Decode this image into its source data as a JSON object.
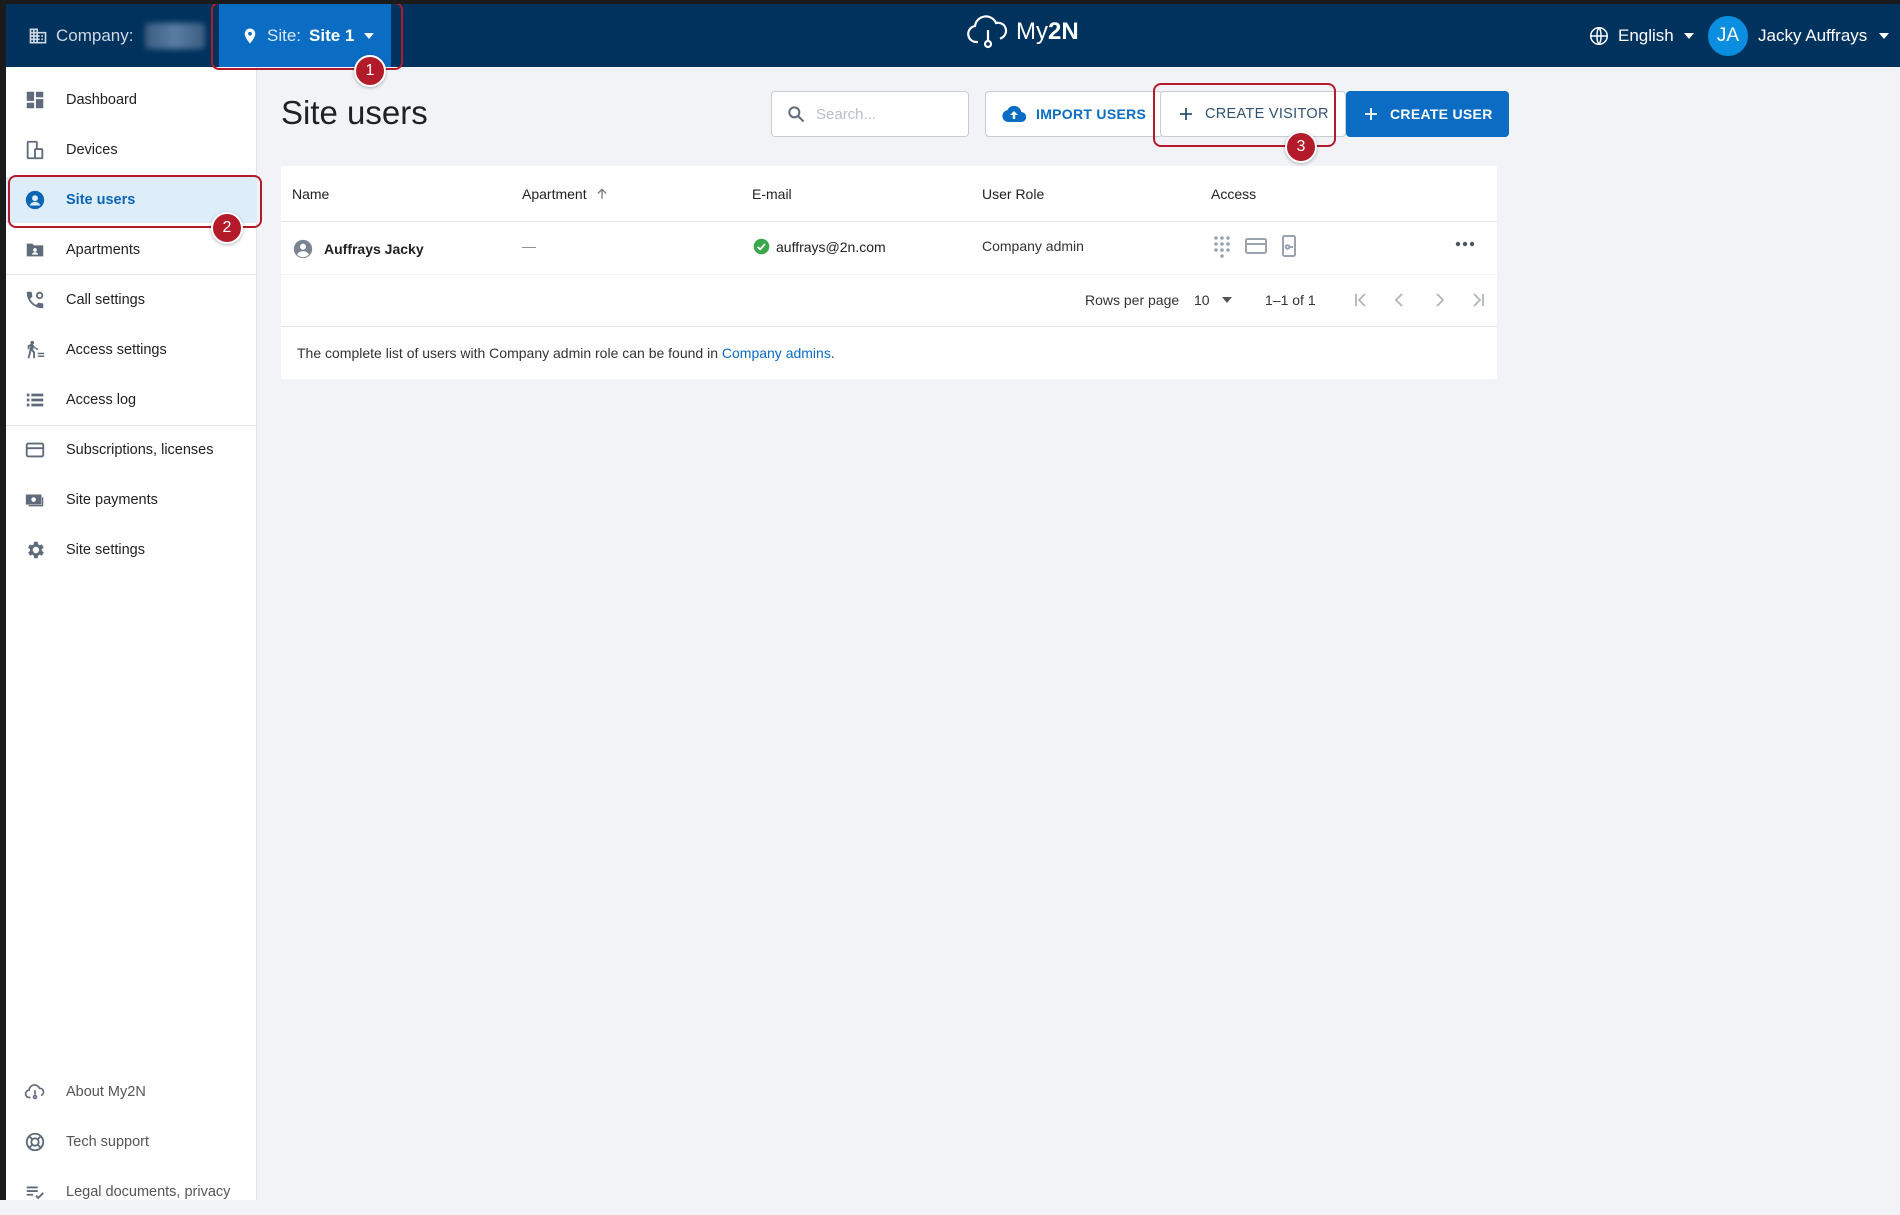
{
  "header": {
    "company_label": "Company:",
    "site_label": "Site:",
    "site_value": "Site 1",
    "logo_text_a": "My",
    "logo_text_b": "2N",
    "language": "English",
    "user_initials": "JA",
    "user_name": "Jacky Auffrays"
  },
  "sidebar": {
    "items": [
      {
        "label": "Dashboard",
        "icon": "dashboard-icon"
      },
      {
        "label": "Devices",
        "icon": "devices-icon"
      },
      {
        "label": "Site users",
        "icon": "site-users-icon"
      },
      {
        "label": "Apartments",
        "icon": "apartments-icon"
      },
      {
        "label": "Call settings",
        "icon": "call-settings-icon"
      },
      {
        "label": "Access settings",
        "icon": "access-settings-icon"
      },
      {
        "label": "Access log",
        "icon": "access-log-icon"
      },
      {
        "label": "Subscriptions, licenses",
        "icon": "subscriptions-icon"
      },
      {
        "label": "Site payments",
        "icon": "site-payments-icon"
      },
      {
        "label": "Site settings",
        "icon": "site-settings-icon"
      }
    ],
    "footer_items": [
      {
        "label": "About My2N",
        "icon": "cloud-icon"
      },
      {
        "label": "Tech support",
        "icon": "lifebuoy-icon"
      },
      {
        "label": "Legal documents, privacy",
        "icon": "legal-icon"
      }
    ],
    "active_item": "Site users"
  },
  "main": {
    "title": "Site users",
    "search_placeholder": "Search...",
    "import_button": "IMPORT USERS",
    "create_visitor_button": "CREATE VISITOR",
    "create_user_button": "CREATE USER",
    "table": {
      "columns": [
        "Name",
        "Apartment",
        "E-mail",
        "User Role",
        "Access"
      ],
      "rows": [
        {
          "name": "Auffrays Jacky",
          "apartment": "—",
          "email": "auffrays@2n.com",
          "role": "Company admin"
        }
      ]
    },
    "pagination": {
      "rows_per_page_label": "Rows per page",
      "rows_per_page": "10",
      "range": "1–1 of 1"
    },
    "footnote_text": "The complete list of users with Company admin role can be found in ",
    "footnote_link": "Company admins",
    "footnote_end": "."
  },
  "annotations": [
    "1",
    "2",
    "3"
  ],
  "colors": {
    "topbar": "#00325e",
    "accent": "#0a6cc3",
    "highlight": "#b41b2a",
    "active_bg": "#deedfa"
  }
}
